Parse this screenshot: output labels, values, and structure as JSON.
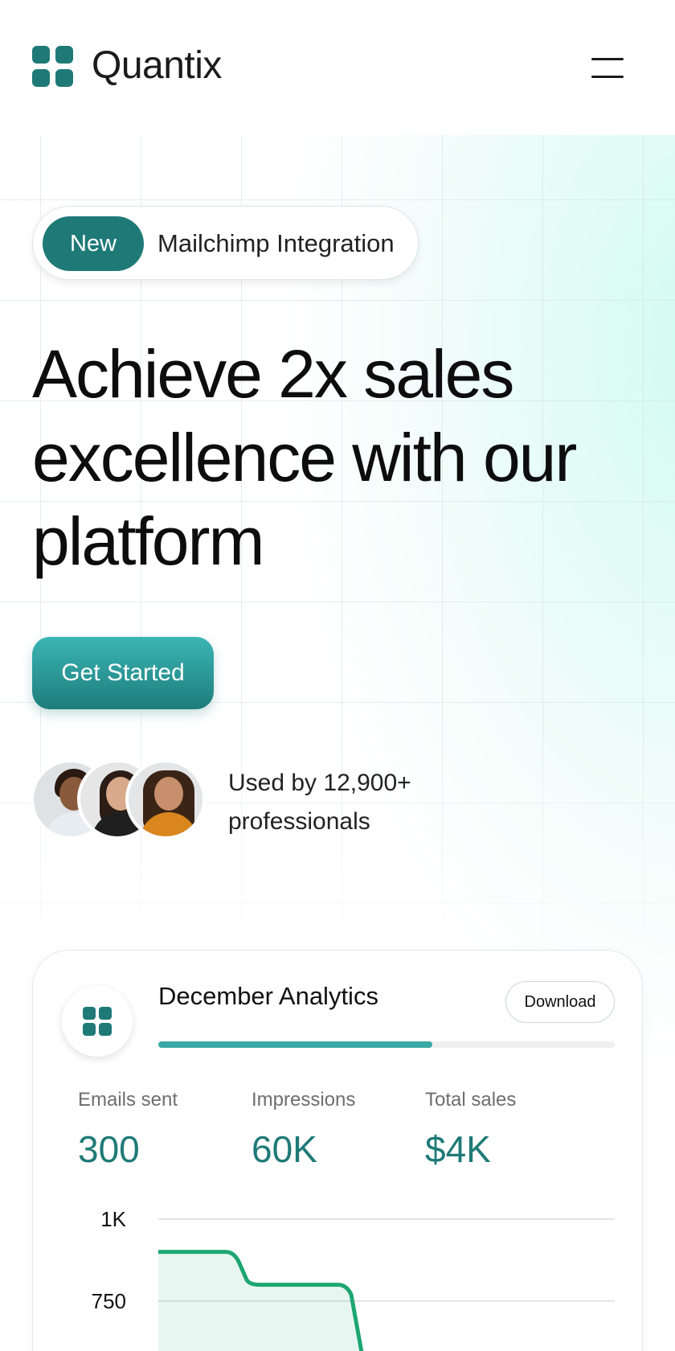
{
  "header": {
    "brand": "Quantix",
    "logo_icon": "grid-four-squares-icon",
    "menu_icon": "hamburger-menu-icon"
  },
  "announcement": {
    "badge": "New",
    "text": "Mailchimp Integration"
  },
  "hero": {
    "headline_lines": [
      "Achieve 2x sales",
      "excellence with our",
      "platform"
    ],
    "cta_label": "Get Started",
    "social_proof_lines": [
      "Used by 12,900+",
      "professionals"
    ],
    "avatars": [
      "man-avatar",
      "woman-dark-hair-avatar",
      "woman-curly-hair-avatar"
    ]
  },
  "analytics_card": {
    "title": "December Analytics",
    "download_label": "Download",
    "progress": 0.6,
    "stats": [
      {
        "label": "Emails sent",
        "value": "300"
      },
      {
        "label": "Impressions",
        "value": "60K"
      },
      {
        "label": "Total sales",
        "value": "$4K"
      }
    ]
  },
  "colors": {
    "accent": "#1f7a77",
    "accent_light": "#3aa8a4",
    "chart_line": "#1da672"
  },
  "chart_data": {
    "type": "area",
    "y_ticks": [
      "1K",
      "750"
    ],
    "ylim": [
      0,
      1000
    ],
    "series": [
      {
        "values": [
          900,
          900,
          800,
          800,
          700
        ]
      }
    ]
  }
}
